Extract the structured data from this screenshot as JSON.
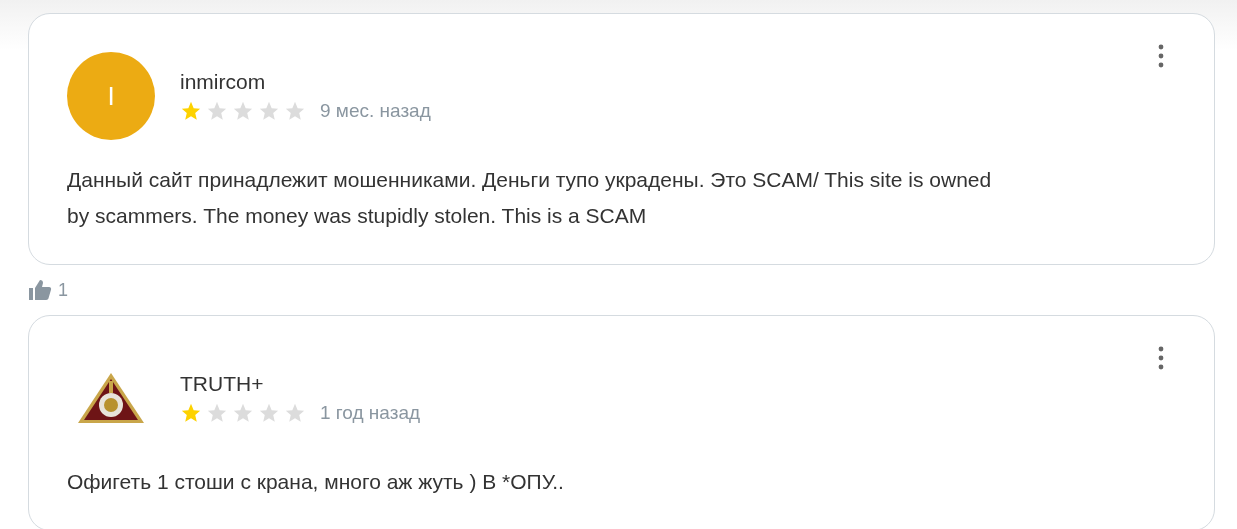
{
  "reviews": [
    {
      "author": "inmircom",
      "avatar": {
        "kind": "letter",
        "letter": "I",
        "color": "#ecab13"
      },
      "stars": 1,
      "time": "9 мес. назад",
      "text": "Данный сайт принадлежит мошенниками. Деньги тупо украдены. Это SCAM/ This site is owned by scammers. The money was stupidly stolen. This is a SCAM",
      "likes": "1"
    },
    {
      "author": "TRUTH+",
      "stars": 1,
      "time": "1 год назад",
      "text": "Офигеть 1 стоши с крана, много аж жуть ) В *ОПУ.."
    }
  ]
}
